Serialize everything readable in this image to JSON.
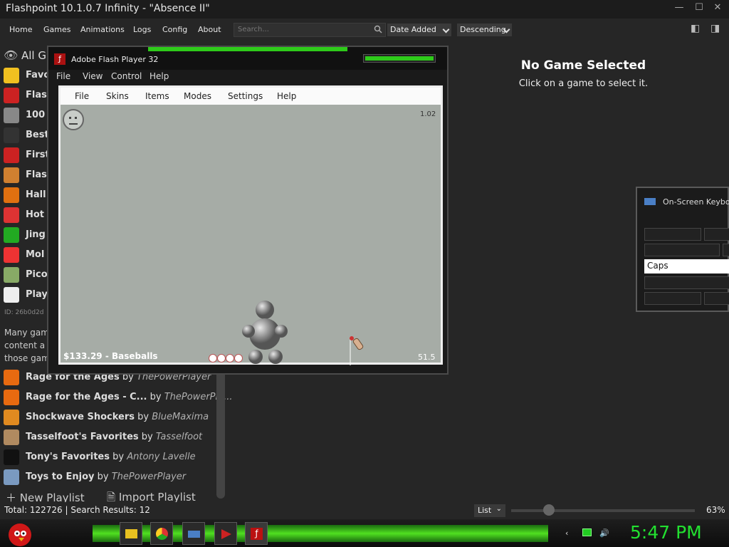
{
  "window": {
    "title": "Flashpoint 10.1.0.7 Infinity - \"Absence II\"",
    "minimize": "—",
    "maximize": "☐",
    "close": "✕"
  },
  "menu": {
    "items": [
      "Home",
      "Games",
      "Animations",
      "Logs",
      "Config",
      "About"
    ]
  },
  "search": {
    "placeholder": "Search..."
  },
  "sort": {
    "field": "Date Added",
    "order": "Descending"
  },
  "sidebar": {
    "all_label": "All G",
    "truncated": [
      "Favo",
      "Flas",
      "100",
      "Best",
      "First",
      "Flas",
      "Hall",
      "Hot",
      "Jing",
      "Mol",
      "Pico",
      "Play"
    ],
    "id_line": "ID: 26b0d2d",
    "desc": [
      "Many gam",
      "content a",
      "those gam"
    ],
    "playlists": [
      {
        "name": "Rage for the Ages",
        "by": "by",
        "author": "ThePowerPlayer",
        "icon_color": "#e86a10"
      },
      {
        "name": "Rage for the Ages - C...",
        "by": "by",
        "author": "ThePowerPla...",
        "icon_color": "#e86a10"
      },
      {
        "name": "Shockwave Shockers",
        "by": "by",
        "author": "BlueMaxima",
        "icon_color": "#e08a20"
      },
      {
        "name": "Tasselfoot's Favorites",
        "by": "by",
        "author": "Tasselfoot",
        "icon_color": "#b08a60"
      },
      {
        "name": "Tony's Favorites",
        "by": "by",
        "author": "Antony Lavelle",
        "icon_color": "#111111"
      },
      {
        "name": "Toys to Enjoy",
        "by": "by",
        "author": "ThePowerPlayer",
        "icon_color": "#7a9ac0"
      }
    ],
    "new_playlist": "New Playlist",
    "import_playlist": "Import Playlist"
  },
  "details": {
    "heading": "No Game Selected",
    "sub": "Click on a game to select it."
  },
  "status": {
    "text": "Total: 122726 | Search Results: 12",
    "view": "List",
    "zoom": "63%",
    "zoom_level": 0.21
  },
  "flash": {
    "title": "Adobe Flash Player 32",
    "menu": [
      "File",
      "View",
      "Control",
      "Help"
    ],
    "game_menu": [
      "File",
      "Skins",
      "Items",
      "Modes",
      "Settings",
      "Help"
    ],
    "version": "1.02",
    "money": "$133.29  -  Baseballs",
    "number": "51.5"
  },
  "keyboard": {
    "title": "On-Screen Keyboa",
    "caps": "Caps"
  },
  "clock": "5:47 PM",
  "colors": {
    "accent": "#22e030",
    "bg": "#262626"
  }
}
